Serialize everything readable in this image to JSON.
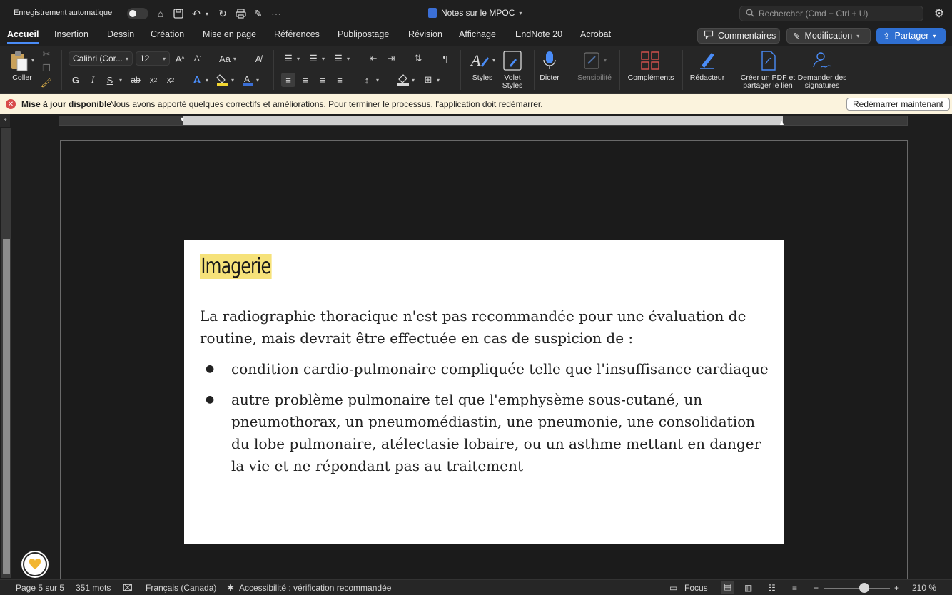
{
  "titlebar": {
    "autosave_label": "Enregistrement automatique",
    "doc_title": "Notes sur le MPOC",
    "search_placeholder": "Rechercher (Cmd + Ctrl + U)"
  },
  "tabs": [
    {
      "label": "Accueil",
      "active": true
    },
    {
      "label": "Insertion"
    },
    {
      "label": "Dessin"
    },
    {
      "label": "Création"
    },
    {
      "label": "Mise en page"
    },
    {
      "label": "Références"
    },
    {
      "label": "Publipostage"
    },
    {
      "label": "Révision"
    },
    {
      "label": "Affichage"
    },
    {
      "label": "EndNote 20"
    },
    {
      "label": "Acrobat"
    }
  ],
  "actions": {
    "comments": "Commentaires",
    "editing": "Modification",
    "share": "Partager"
  },
  "ribbon": {
    "paste_label": "Coller",
    "font_name": "Calibri (Cor...",
    "font_size": "12",
    "styles_label": "Styles",
    "styles_pane_label_1": "Volet",
    "styles_pane_label_2": "Styles",
    "dictate_label": "Dicter",
    "sensitivity_label": "Sensibilité",
    "addins_label": "Compléments",
    "editor_label": "Rédacteur",
    "create_pdf_label_1": "Créer un PDF et",
    "create_pdf_label_2": "partager le lien",
    "request_sign_label_1": "Demander des",
    "request_sign_label_2": "signatures",
    "bold_glyph": "G",
    "italic_glyph": "I",
    "underline_glyph": "S",
    "strike_glyph": "ab",
    "case_glyph": "Aa"
  },
  "notification": {
    "title": "Mise à jour disponible",
    "message": "Nous avons apporté quelques correctifs et améliorations. Pour terminer le processus, l'application doit  redémarrer.",
    "button": "Redémarrer maintenant"
  },
  "document": {
    "heading": "Imagerie",
    "intro": "La radiographie thoracique n'est pas recommandée pour une évaluation de routine, mais devrait être effectuée en cas de suspicion de :",
    "bullets": [
      "condition cardio-pulmonaire compliquée telle que l'insuffisance cardiaque",
      "autre problème pulmonaire tel que l'emphysème sous-cutané, un pneumothorax, un pneumomédiastin, une pneumonie, une consolidation du lobe pulmonaire, atélectasie lobaire, ou un asthme mettant en danger la vie et ne répondant pas au traitement"
    ]
  },
  "statusbar": {
    "page": "Page 5 sur 5",
    "words": "351 mots",
    "language": "Français (Canada)",
    "accessibility": "Accessibilité : vérification recommandée",
    "focus": "Focus",
    "zoom": "210 %"
  },
  "colors": {
    "accent": "#4a8cf7",
    "share_button": "#2f6fd1",
    "highlight": "#f6e27a",
    "notification_bg": "#fbf3dd"
  }
}
